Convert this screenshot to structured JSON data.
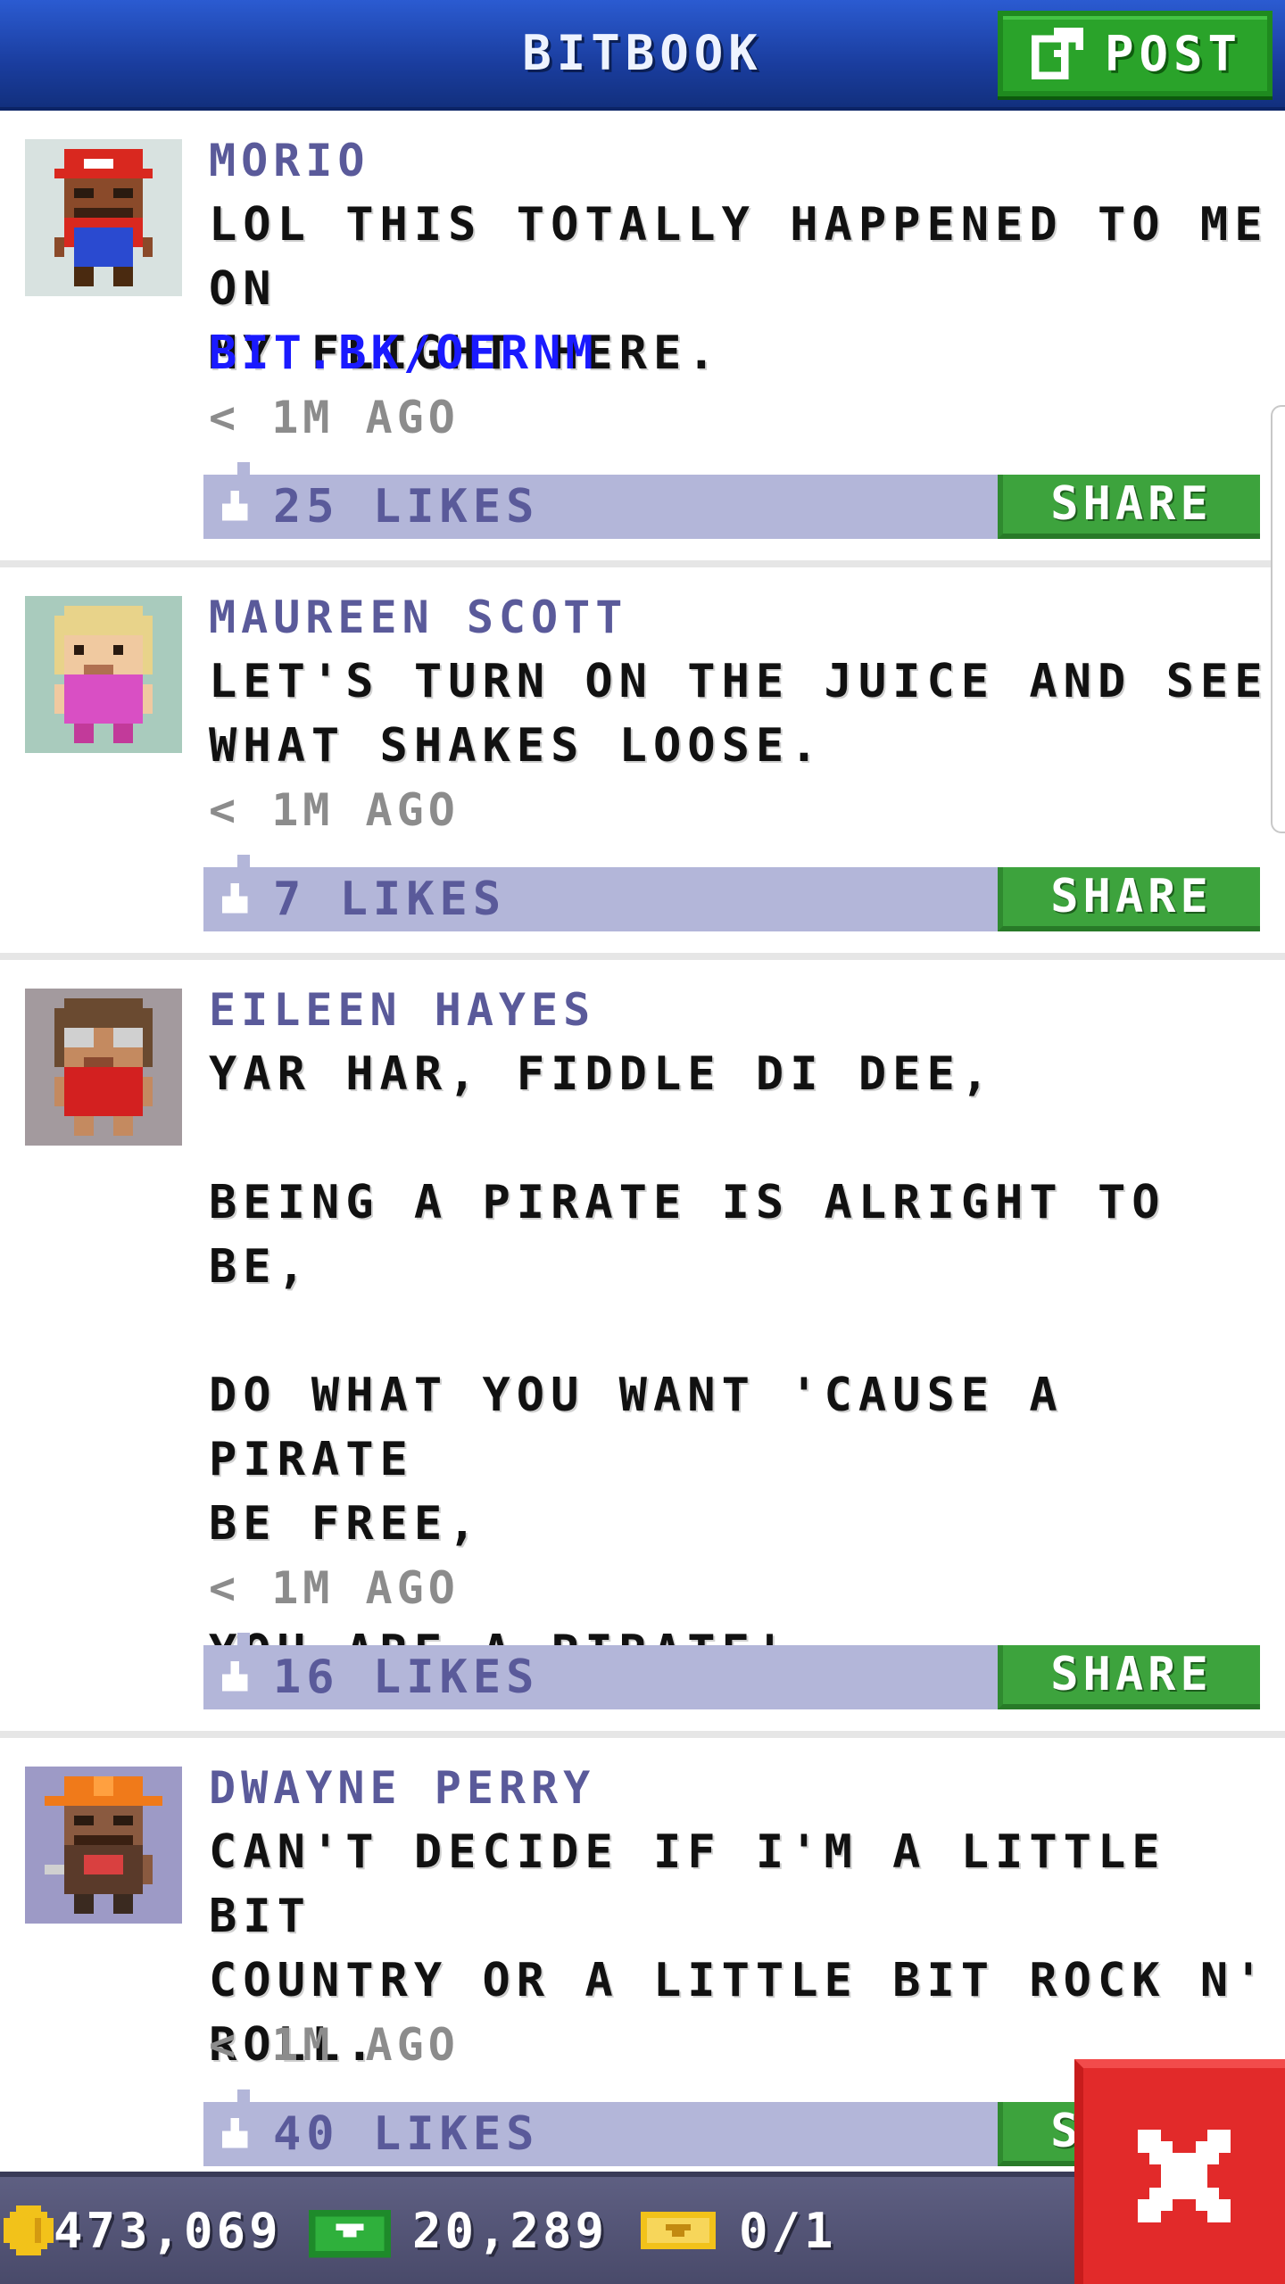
{
  "header": {
    "title": "BITBOOK",
    "post_label": "POST"
  },
  "posts": [
    {
      "author": "MORIO",
      "message": "LOL THIS TOTALLY HAPPENED TO ME ON\nMY FLIGHT HERE.",
      "link": "BIT.BK/OERNM",
      "time": "< 1M AGO",
      "likes": "25 LIKES",
      "share_label": "SHARE",
      "avatar_bg": "#d8e2e0"
    },
    {
      "author": "MAUREEN SCOTT",
      "message": "LET'S TURN ON THE JUICE AND SEE\nWHAT SHAKES LOOSE.",
      "time": "< 1M AGO",
      "likes": "7 LIKES",
      "share_label": "SHARE",
      "avatar_bg": "#a9cbbd"
    },
    {
      "author": "EILEEN HAYES",
      "message": "YAR HAR, FIDDLE DI DEE,\n\nBEING A PIRATE IS ALRIGHT TO BE,\n\nDO WHAT YOU WANT 'CAUSE A PIRATE\nBE FREE,\n\nYOU ARE A PIRATE!",
      "time": "< 1M AGO",
      "likes": "16 LIKES",
      "share_label": "SHARE",
      "avatar_bg": "#a39a9e"
    },
    {
      "author": "DWAYNE PERRY",
      "message": "CAN'T DECIDE IF I'M A LITTLE BIT\nCOUNTRY OR A LITTLE BIT ROCK N'\nROLL.",
      "time": "< 1M AGO",
      "likes": "40 LIKES",
      "share_label": "SHARE",
      "avatar_bg": "#9d9ac6"
    }
  ],
  "status_bar": {
    "coins": "473,069",
    "bux": "20,289",
    "tickets": "0/1"
  },
  "colors": {
    "header_blue": "#1a3d9e",
    "post_green": "#2aa32a",
    "like_bar": "#b3b6d9",
    "author_purple": "#5a5a9a",
    "link_blue": "#1a1aff",
    "close_red": "#e22a2a"
  }
}
